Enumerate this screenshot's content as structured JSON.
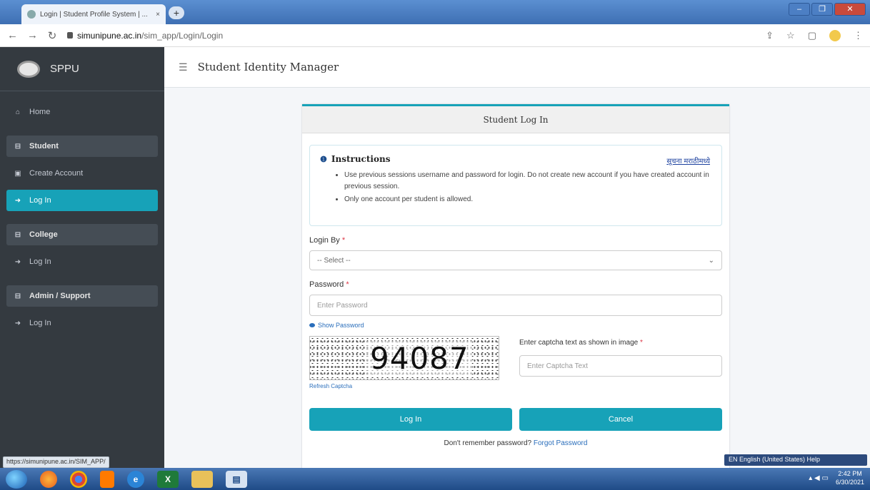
{
  "browser": {
    "tab_title": "Login | Student Profile System | ...",
    "tab_close": "×",
    "new_tab": "+",
    "url_domain": "simunipune.ac.in",
    "url_path": "/sim_app/Login/Login",
    "status_url": "https://simunipune.ac.in/SIM_APP/",
    "language_bar": "EN English (United States)  Help"
  },
  "sidebar": {
    "brand": "SPPU",
    "items": [
      {
        "icon": "home-icon",
        "glyph": "⌂",
        "label": "Home"
      },
      {
        "icon": "lock-icon",
        "glyph": "🔒",
        "label": "Student"
      },
      {
        "icon": "id-card-icon",
        "glyph": "▣",
        "label": "Create Account"
      },
      {
        "icon": "login-icon",
        "glyph": "➜",
        "label": "Log In"
      },
      {
        "icon": "lock-icon",
        "glyph": "🔒",
        "label": "College"
      },
      {
        "icon": "login-icon",
        "glyph": "➜",
        "label": "Log In"
      },
      {
        "icon": "lock-icon",
        "glyph": "🔒",
        "label": "Admin / Support"
      },
      {
        "icon": "login-icon",
        "glyph": "➜",
        "label": "Log In"
      }
    ]
  },
  "header": {
    "title": "Student Identity Manager"
  },
  "card": {
    "title": "Student Log In",
    "instructions": {
      "heading": "Instructions",
      "link": "सूचना मराठीमध्ये",
      "items": [
        "Use previous sessions username and password for login. Do not create new account if you have created account in previous session.",
        "Only one account per student is allowed."
      ]
    },
    "login_by": {
      "label": "Login By",
      "value": "-- Select --"
    },
    "password": {
      "label": "Password",
      "placeholder": "Enter Password",
      "show": "Show Password"
    },
    "captcha": {
      "text": "94087",
      "refresh": "Refresh Captcha",
      "label": "Enter captcha text as shown in image",
      "placeholder": "Enter Captcha Text"
    },
    "buttons": {
      "login": "Log In",
      "cancel": "Cancel"
    },
    "forgot": {
      "text": "Don't remember password?",
      "link": "Forgot Password"
    }
  },
  "taskbar": {
    "time": "2:42 PM",
    "date": "6/30/2021"
  }
}
